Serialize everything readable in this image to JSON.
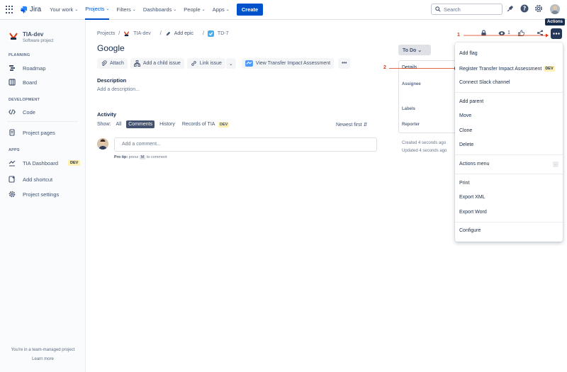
{
  "topnav": {
    "logo": "Jira",
    "items": [
      "Your work",
      "Projects",
      "Filters",
      "Dashboards",
      "People",
      "Apps"
    ],
    "create": "Create",
    "search_placeholder": "Search"
  },
  "sidebar": {
    "project_name": "TIA-dev",
    "project_type": "Software project",
    "sections": [
      "PLANNING",
      "DEVELOPMENT",
      "APPS"
    ],
    "items": [
      "Roadmap",
      "Board",
      "Code",
      "Project pages",
      "TIA Dashboard",
      "Add shortcut",
      "Project settings"
    ],
    "dev_badge": "DEV",
    "footer": "You're in a team-managed project",
    "learn_more": "Learn more"
  },
  "breadcrumb": [
    "Projects",
    "TIA-dev",
    "Add epic",
    "TD-7"
  ],
  "issue": {
    "title": "Google",
    "buttons": [
      "Attach",
      "Add a child issue",
      "Link issue",
      "View Transfer Impact Assessment"
    ],
    "description_label": "Description",
    "description_placeholder": "Add a description...",
    "activity_label": "Activity",
    "show_label": "Show:",
    "filters": [
      "All",
      "Comments",
      "History",
      "Records of TIA"
    ],
    "dev_badge": "DEV",
    "sort": "Newest first",
    "comment_placeholder": "Add a comment...",
    "protip_label": "Pro tip:",
    "protip_text": "press",
    "protip_key": "M",
    "protip_end": "to comment"
  },
  "side_panel": {
    "status": "To Do",
    "details": "Details",
    "assignee": "Assignee",
    "labels": "Labels",
    "reporter": "Reporter",
    "created": "Created 4 seconds ago",
    "updated": "Updated 4 seconds ago"
  },
  "header_actions": {
    "watch_count": "1",
    "tooltip": "Actions"
  },
  "annotations": [
    "1",
    "2"
  ],
  "menu": {
    "items": [
      "Add flag",
      "Register Transfer Impact Assessment",
      "Connect Slack channel",
      "Add parent",
      "Move",
      "Clone",
      "Delete",
      "Actions menu",
      "Print",
      "Export XML",
      "Export Word",
      "Configure"
    ],
    "dev_badge": "DEV",
    "key_hint": "."
  },
  "colors": {
    "accent": "#0052cc",
    "annotation": "#de350b"
  }
}
